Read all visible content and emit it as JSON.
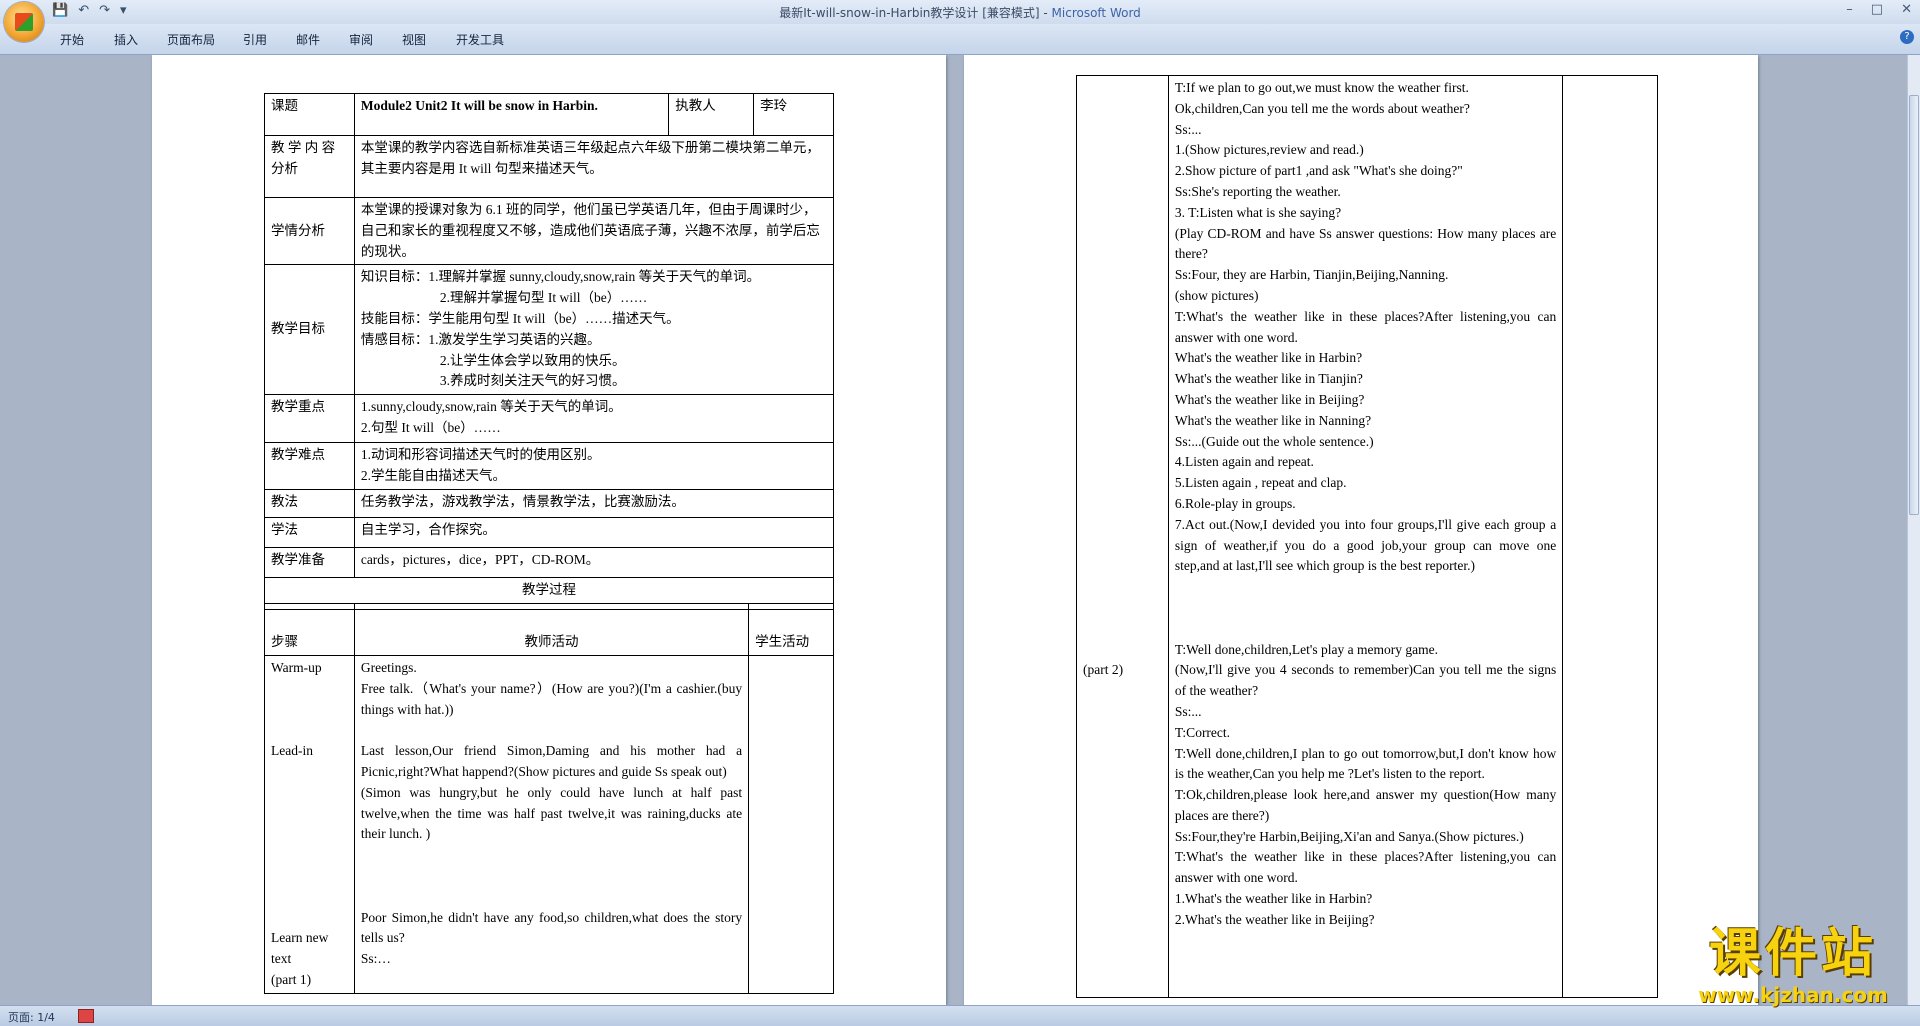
{
  "window": {
    "title": "最新It-will-snow-in-Harbin教学设计 [兼容模式] - ",
    "app_name": "Microsoft Word",
    "controls": [
      "–",
      "□",
      "✕"
    ]
  },
  "quick_access": [
    "save-icon",
    "undo-icon",
    "redo-icon",
    "customize-icon"
  ],
  "ribbon": {
    "tabs": [
      "开始",
      "插入",
      "页面布局",
      "引用",
      "邮件",
      "审阅",
      "视图",
      "开发工具"
    ],
    "help": "?"
  },
  "status": {
    "page": "页面: 1/4"
  },
  "watermark": {
    "main": "课件站",
    "url": "www.kjzhan.com"
  },
  "page1": {
    "header": {
      "topic_label": "课题",
      "topic_value": "Module2 Unit2    It will be snow in Harbin.",
      "teacher_label": "执教人",
      "teacher_value": "李玲"
    },
    "rows": [
      {
        "label": "教 学 内 容 分析",
        "text": "本堂课的教学内容选自新标准英语三年级起点六年级下册第二模块第二单元，其主要内容是用 It will 句型来描述天气。"
      },
      {
        "label": "学情分析",
        "text": "本堂课的授课对象为 6.1 班的同学，他们虽已学英语几年，但由于周课时少，自己和家长的重视程度又不够，造成他们英语底子薄，兴趣不浓厚，前学后忘的现状。"
      },
      {
        "label": "教学目标",
        "lines": [
          "知识目标：1.理解并掌握 sunny,cloudy,snow,rain 等关于天气的单词。",
          "2.理解并掌握句型 It will（be）……",
          "技能目标：学生能用句型 It will（be）……描述天气。",
          "情感目标：1.激发学生学习英语的兴趣。",
          "2.让学生体会学以致用的快乐。",
          "3.养成时刻关注天气的好习惯。"
        ]
      },
      {
        "label": "教学重点",
        "lines": [
          "1.sunny,cloudy,snow,rain 等关于天气的单词。",
          "2.句型 It will（be）……"
        ]
      },
      {
        "label": "教学难点",
        "lines": [
          "1.动词和形容词描述天气时的使用区别。",
          "2.学生能自由描述天气。"
        ]
      },
      {
        "label": "教法",
        "text": "任务教学法，游戏教学法，情景教学法，比赛激励法。"
      },
      {
        "label": "学法",
        "text": "自主学习，合作探究。"
      },
      {
        "label": "教学准备",
        "text": "cards，pictures，dice，PPT，CD-ROM。"
      }
    ],
    "process_title": "教学过程",
    "process_headers": [
      "步骤",
      "教师活动",
      "学生活动"
    ],
    "steps": [
      "Warm-up",
      "",
      "",
      "",
      "Lead-in",
      "",
      "",
      "",
      "",
      "",
      "",
      "",
      "",
      "",
      "Learn new text",
      "(part 1)"
    ],
    "teacher": [
      "Greetings.",
      "Free talk.（What's your name?）(How are you?)(I'm a cashier.(buy things with hat.))",
      "",
      "Last lesson,Our friend Simon,Daming and his mother had a Picnic,right?What happend?(Show pictures and guide Ss speak out)",
      "(Simon was hungry,but he only could have lunch at half past twelve,when the time was half past twelve,it was raining,ducks ate their lunch. )",
      "",
      "",
      "",
      "Poor Simon,he didn't have any food,so children,what does the story tells us?",
      "Ss:…"
    ]
  },
  "page2": {
    "steps_col": [
      "",
      "",
      "",
      "",
      "",
      "",
      "",
      "",
      "",
      "",
      "",
      "",
      "",
      "",
      "",
      "",
      "",
      "",
      "",
      "",
      "",
      "",
      "",
      "",
      "",
      "",
      "",
      "",
      "(part 2)",
      "",
      "",
      "",
      "",
      "",
      "",
      "",
      "",
      "",
      "",
      "",
      "",
      "",
      "",
      ""
    ],
    "teacher": [
      "T:If we plan to go out,we must know the weather first.",
      "Ok,children,Can you tell me the words about weather?",
      "  Ss:...",
      "1.(Show pictures,review and read.)",
      "2.Show picture of part1 ,and ask \"What's she doing?\"",
      "Ss:She's reporting the weather.",
      "3. T:Listen what is she saying?",
      "(Play CD-ROM and have Ss answer questions: How many places are there?",
      "Ss:Four, they are Harbin, Tianjin,Beijing,Nanning.",
      "(show pictures)",
      "T:What's the weather like in these places?After listening,you can answer with one word.",
      "What's the weather like in Harbin?",
      "What's the weather like in Tianjin?",
      "What's the weather like in Beijing?",
      "What's the weather like in Nanning?",
      "Ss:...(Guide out the whole sentence.)",
      "4.Listen again and repeat.",
      "5.Listen again , repeat and clap.",
      "6.Role-play in groups.",
      "7.Act out.(Now,I devided you into four groups,I'll give each group a sign of weather,if you do a good job,your group can move one step,and at last,I'll see which group is the best reporter.)",
      "",
      "",
      "",
      "T:Well done,children,Let's play a memory game.",
      "(Now,I'll give you 4 seconds to remember)Can you tell me the signs of the weather?",
      "Ss:...",
      "T:Correct.",
      "T:Well done,children,I plan to go out tomorrow,but,I don't know how is the weather,Can you help me ?Let's listen to the report.",
      "T:Ok,children,please look here,and answer my question(How many places are there?)",
      "Ss:Four,they're Harbin,Beijing,Xi'an and Sanya.(Show pictures.)",
      "T:What's the weather like in these places?After listening,you can answer with one word.",
      "1.What's the weather like in Harbin?",
      "2.What's the weather like in Beijing?"
    ]
  }
}
